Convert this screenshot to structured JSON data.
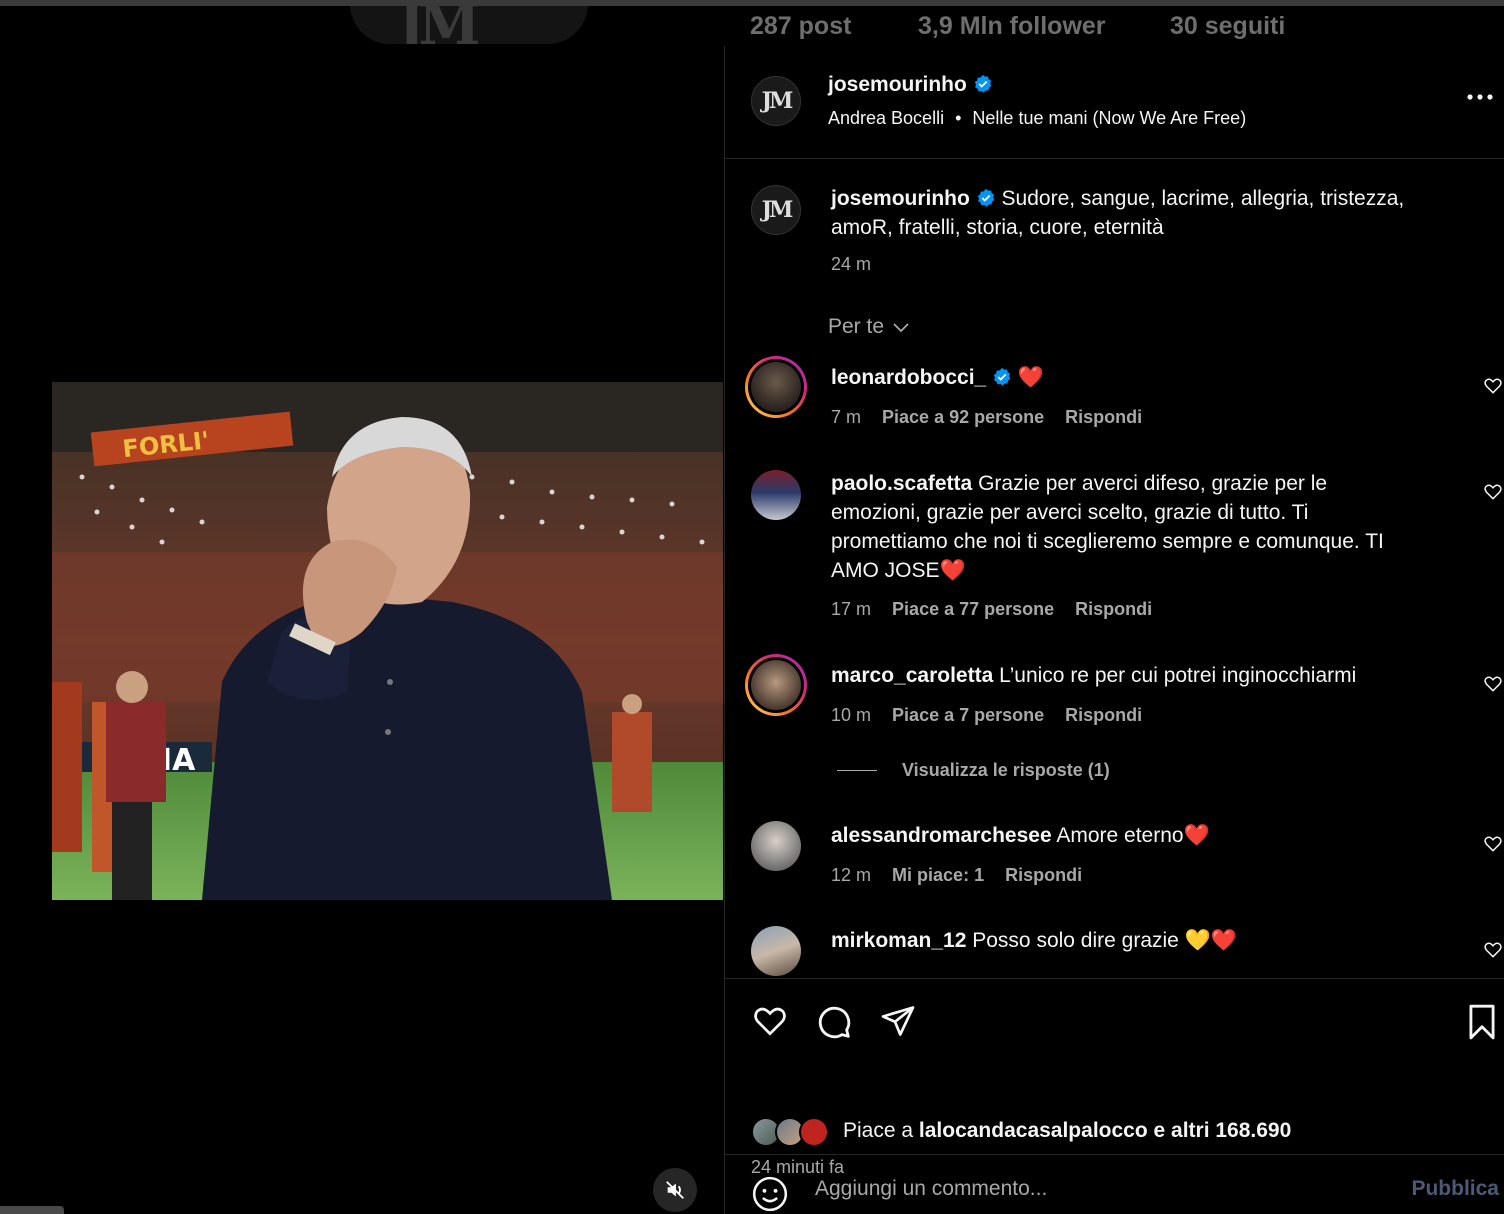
{
  "profile_stats": {
    "posts": "287 post",
    "followers": "3,9 Mln follower",
    "following": "30 seguiti"
  },
  "post": {
    "author": "josemourinho",
    "author_avatar_text": "JM",
    "music_artist": "Andrea Bocelli",
    "music_separator": "•",
    "music_title": "Nelle tue mani (Now We Are Free)",
    "caption_line1": "Sudore, sangue, lacrime, allegria, tristezza,",
    "caption_line2": "amoR, fratelli, storia, cuore, eternità",
    "caption_time": "24 m",
    "sort_label": "Per te"
  },
  "comments": [
    {
      "username": "leonardobocci_",
      "verified": true,
      "lines": [
        "❤️"
      ],
      "time": "7 m",
      "likes": "Piace a 92 persone",
      "reply": "Rispondi"
    },
    {
      "username": "paolo.scafetta",
      "verified": false,
      "lines": [
        "Grazie per averci difeso, grazie per le",
        "emozioni, grazie per averci scelto, grazie di tutto. Ti",
        "promettiamo che noi ti sceglieremo sempre e comunque. TI",
        "AMO JOSE❤️"
      ],
      "time": "17 m",
      "likes": "Piace a 77 persone",
      "reply": "Rispondi"
    },
    {
      "username": "marco_caroletta",
      "verified": false,
      "lines": [
        "L’unico re per cui potrei inginocchiarmi"
      ],
      "time": "10 m",
      "likes": "Piace a 7 persone",
      "reply": "Rispondi",
      "view_replies": "Visualizza le risposte (1)"
    },
    {
      "username": "alessandromarchesee",
      "verified": false,
      "lines": [
        "Amore eterno❤️"
      ],
      "time": "12 m",
      "likes": "Mi piace: 1",
      "reply": "Rispondi"
    },
    {
      "username": "mirkoman_12",
      "verified": false,
      "lines": [
        "Posso solo dire grazie 💛❤️"
      ]
    }
  ],
  "likes_summary": {
    "prefix": "Piace a",
    "user": "lalocandacasalpalocco",
    "suffix": "e altri 168.690",
    "time_ago": "24 minuti fa"
  },
  "comment_box": {
    "placeholder": "Aggiungi un commento...",
    "publish": "Pubblica"
  },
  "colors": {
    "background": "#000000",
    "text": "#f5f5f5",
    "secondary": "#a8a8a8",
    "verified": "#0095f6",
    "divider": "#262626",
    "story_ring_start": "#feda75",
    "story_ring_end": "#d62976",
    "publish_disabled": "#4c5a78"
  },
  "icons": [
    "verified-badge-icon",
    "more-icon",
    "heart-icon",
    "comment-icon",
    "share-icon",
    "bookmark-icon",
    "emoji-icon",
    "mute-icon",
    "chevron-down-icon"
  ]
}
